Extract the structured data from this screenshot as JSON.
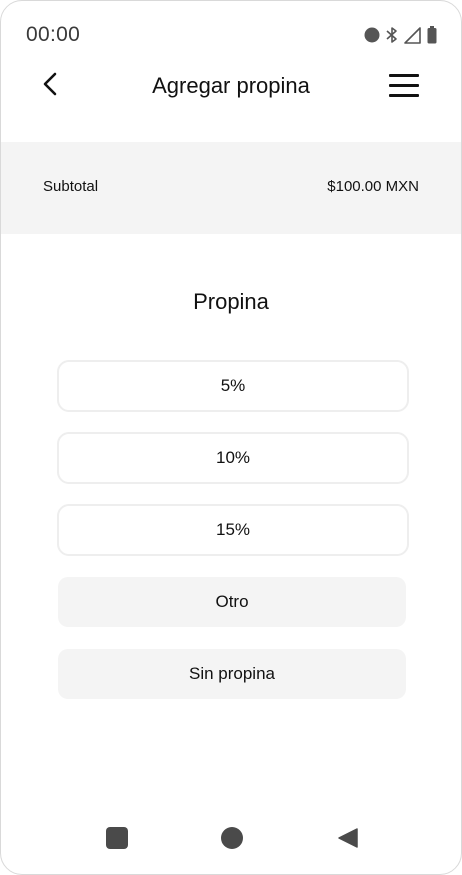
{
  "status_bar": {
    "time": "00:00",
    "icons": [
      "record-dot-icon",
      "bluetooth-icon",
      "cell-signal-icon",
      "battery-icon"
    ]
  },
  "header": {
    "title": "Agregar propina",
    "back_icon": "chevron-left-icon",
    "menu_icon": "hamburger-menu-icon"
  },
  "subtotal": {
    "label": "Subtotal",
    "value": "$100.00 MXN"
  },
  "tip": {
    "title": "Propina",
    "options": [
      {
        "label": "5%"
      },
      {
        "label": "10%"
      },
      {
        "label": "15%"
      },
      {
        "label": "Otro"
      },
      {
        "label": "Sin propina"
      }
    ]
  },
  "nav_bar": {
    "icons": [
      "recents-square-icon",
      "home-circle-icon",
      "back-triangle-icon"
    ]
  },
  "colors": {
    "background": "#ffffff",
    "subtotal_band": "#f4f4f4",
    "option_border": "#eeeeee",
    "option_fill": "#f4f4f4",
    "text": "#111111",
    "nav_icon": "#4a4a4a"
  }
}
